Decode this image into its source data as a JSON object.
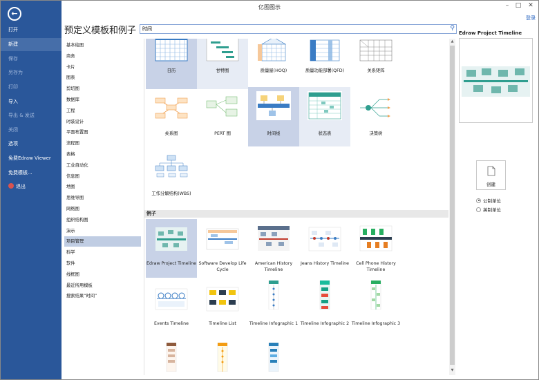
{
  "window": {
    "title": "亿图图示",
    "minimize": "–",
    "restore": "□",
    "close": "✕"
  },
  "leftnav": {
    "back_icon": "←",
    "items": [
      {
        "label": "打开"
      },
      {
        "label": "新建"
      },
      {
        "label": "保存"
      },
      {
        "label": "另存为"
      },
      {
        "label": "打印"
      },
      {
        "label": "导入"
      },
      {
        "label": "导出 & 发送"
      },
      {
        "label": "关闭"
      },
      {
        "label": "选项"
      },
      {
        "label": "免费Edraw Viewer"
      },
      {
        "label": "免费模板..."
      },
      {
        "label": "退出"
      }
    ]
  },
  "header": {
    "title": "预定义模板和例子",
    "signin": "登录"
  },
  "search": {
    "value": "时间",
    "icon": "search-icon"
  },
  "categories": [
    "基本绘图",
    "商务",
    "卡片",
    "图表",
    "剪切图",
    "数据库",
    "工程",
    "时装设计",
    "平面布置图",
    "流程图",
    "表格",
    "工业自动化",
    "信息图",
    "地图",
    "思维导图",
    "网络图",
    "组织结构图",
    "演示",
    "项目管理",
    "科学",
    "软件",
    "线框图",
    "最近所用模板",
    "搜索结果“时间”"
  ],
  "templates": [
    {
      "label": "日历"
    },
    {
      "label": "甘特图"
    },
    {
      "label": "质量屋(HOQ)"
    },
    {
      "label": "质量功能部署(QFD)"
    },
    {
      "label": "关系矩阵"
    },
    {
      "label": "关系图"
    },
    {
      "label": "PERT 图"
    },
    {
      "label": "时间线"
    },
    {
      "label": "状态表"
    },
    {
      "label": "决策树"
    },
    {
      "label": "工作分解结构(WBS)"
    }
  ],
  "examples_header": "例子",
  "examples": [
    {
      "label": "Edraw Project Timeline"
    },
    {
      "label": "Software Develop Life Cycle"
    },
    {
      "label": "American History Timeline"
    },
    {
      "label": "Jeans History Timeline"
    },
    {
      "label": "Cell Phone History Timeline"
    },
    {
      "label": "Events Timeline"
    },
    {
      "label": "Timeline List"
    },
    {
      "label": "Timeline Infographic 1"
    },
    {
      "label": "Timeline Infographic 2"
    },
    {
      "label": "Timeline Infographic 3"
    }
  ],
  "preview": {
    "title": "Edraw Project Timeline"
  },
  "create": {
    "label": "创建"
  },
  "units": [
    {
      "label": "公制单位",
      "selected": true
    },
    {
      "label": "英制单位",
      "selected": false
    }
  ],
  "scroll": {
    "up": "▲",
    "down": "▼"
  }
}
